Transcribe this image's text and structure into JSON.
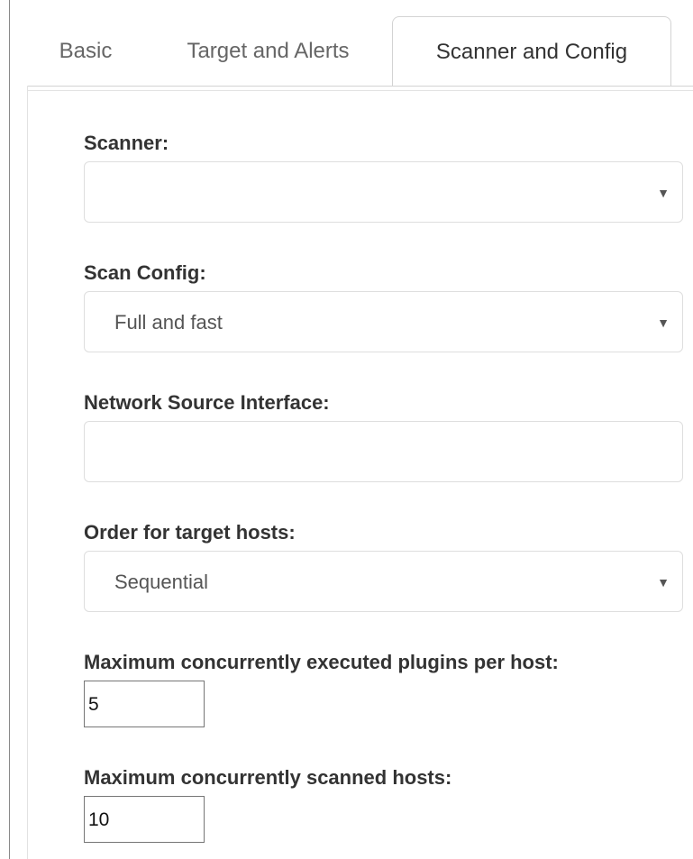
{
  "tabs": {
    "basic": "Basic",
    "target_and_alerts": "Target and Alerts",
    "scanner_and_config": "Scanner and Config",
    "active": "Scanner and Config"
  },
  "form": {
    "scanner": {
      "label": "Scanner:",
      "value": ""
    },
    "scan_config": {
      "label": "Scan Config:",
      "value": "Full and fast"
    },
    "network_source_interface": {
      "label": "Network Source Interface:",
      "value": ""
    },
    "order_target_hosts": {
      "label": "Order for target hosts:",
      "value": "Sequential"
    },
    "max_plugins": {
      "label": "Maximum concurrently executed plugins per host:",
      "value": "5"
    },
    "max_hosts": {
      "label": "Maximum concurrently scanned hosts:",
      "value": "10"
    }
  },
  "icons": {
    "dropdown_arrow": "▼"
  }
}
